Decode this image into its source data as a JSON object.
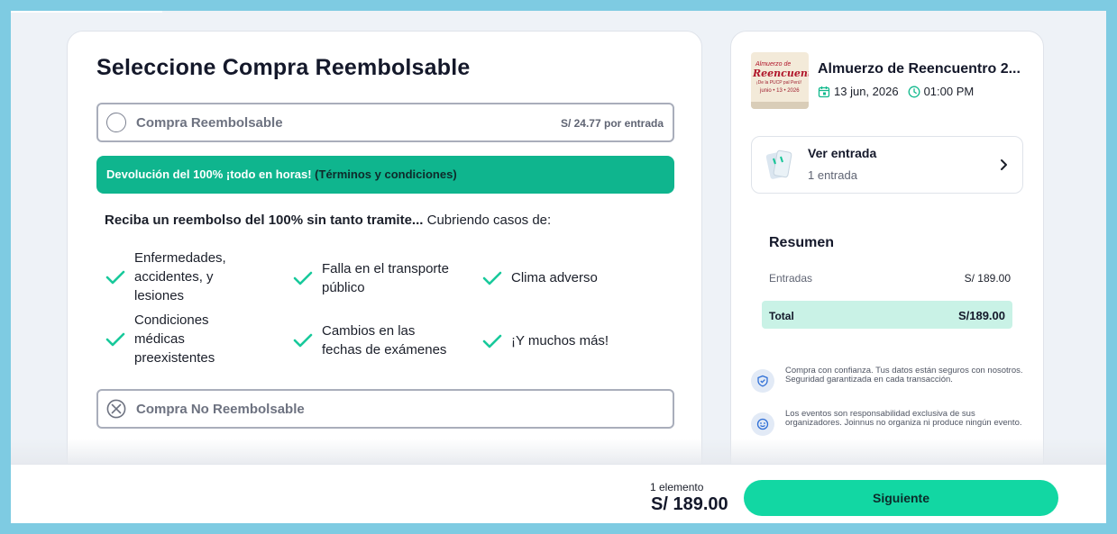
{
  "main": {
    "title": "Seleccione Compra Reembolsable",
    "refundable_option": {
      "label": "Compra Reembolsable",
      "price": "S/ 24.77 por entrada"
    },
    "banner": {
      "text": "Devolución del 100% ¡todo en horas!",
      "terms": "(Términos y condiciones)"
    },
    "intro": {
      "bold": "Reciba un reembolso del 100% sin tanto tramite...",
      "rest": " Cubriendo casos de:"
    },
    "features": [
      [
        "Enfermedades,",
        "accidentes, y",
        "lesiones"
      ],
      [
        "Falla en el transporte",
        "público"
      ],
      [
        "Clima adverso"
      ],
      [
        "Condiciones",
        "médicas",
        "preexistentes"
      ],
      [
        "Cambios en las",
        "fechas de exámenes"
      ],
      [
        "¡Y muchos más!"
      ]
    ],
    "non_refundable_option": {
      "label": "Compra No Reembolsable"
    }
  },
  "event": {
    "poster_text": [
      "Almuerzo de",
      "Reencuentro",
      "¡De la PUCP pal Perú!",
      "junio • 13 • 2026"
    ],
    "title": "Almuerzo de Reencuentro 2...",
    "date": "13 jun, 2026",
    "time": "01:00 PM"
  },
  "ticket": {
    "title": "Ver entrada",
    "subtitle": "1 entrada"
  },
  "summary": {
    "heading": "Resumen",
    "entries_label": "Entradas",
    "entries_amount": "S/ 189.00",
    "total_label": "Total",
    "total_amount": "S/189.00"
  },
  "info": {
    "trust": "Compra con confianza. Tus datos están seguros con nosotros. Seguridad garantizada en cada transacción.",
    "disclaimer": "Los eventos son responsabilidad exclusiva de sus organizadores. Joinnus no organiza ni produce ningún evento."
  },
  "footer": {
    "count": "1 elemento",
    "total": "S/ 189.00",
    "next_label": "Siguiente"
  },
  "colors": {
    "accent": "#12d7a3",
    "banner": "#0fb58e",
    "check": "#18c99b",
    "total_bg": "#c9f2e6"
  },
  "icons": [
    "radio-empty-icon",
    "x-circle-icon",
    "check-icon",
    "calendar-icon",
    "clock-icon",
    "ticket-icon",
    "chevron-right-icon",
    "shield-check-icon",
    "support-face-icon"
  ]
}
